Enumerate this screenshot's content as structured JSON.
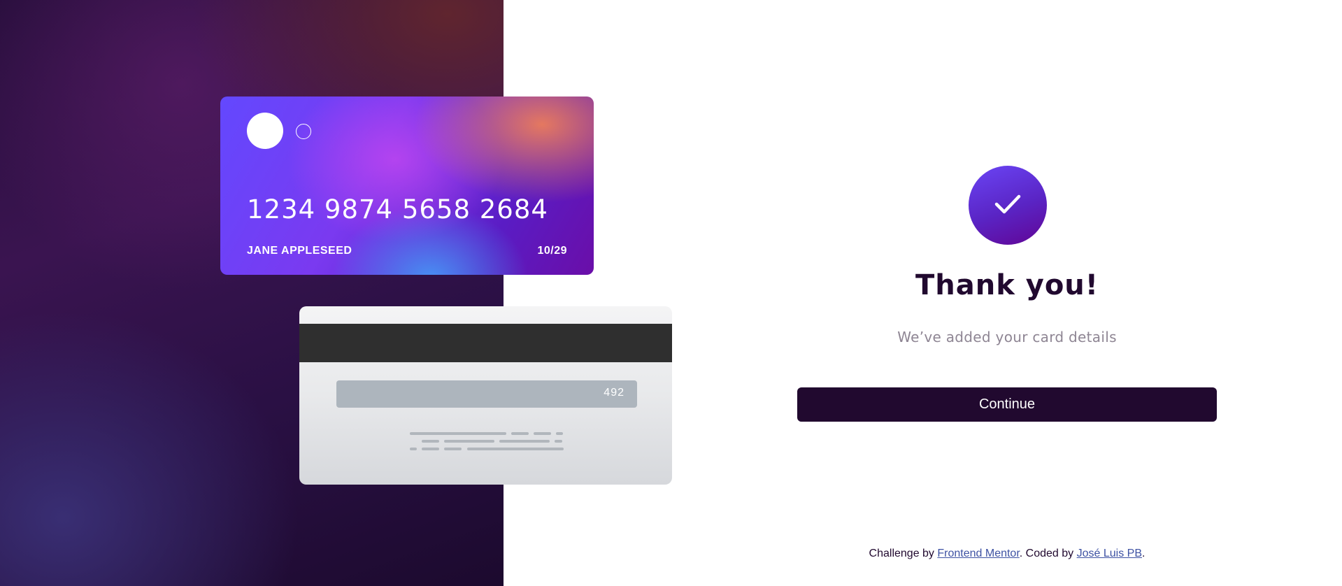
{
  "card_front": {
    "number": "1234 9874 5658 2684",
    "name": "JANE APPLESEED",
    "expiry": "10/29"
  },
  "card_back": {
    "cvc": "492"
  },
  "complete": {
    "icon": "check-icon",
    "title": "Thank you!",
    "subtitle": "We’ve added your card details",
    "continue_label": "Continue"
  },
  "footer": {
    "prefix": "Challenge by ",
    "link1": "Frontend Mentor",
    "middle": ". Coded by ",
    "link2": "José Luis PB",
    "suffix": "."
  },
  "colors": {
    "dark_violet": "#21092f",
    "grayish_violet": "#8e8593",
    "link": "#3e52a3"
  }
}
